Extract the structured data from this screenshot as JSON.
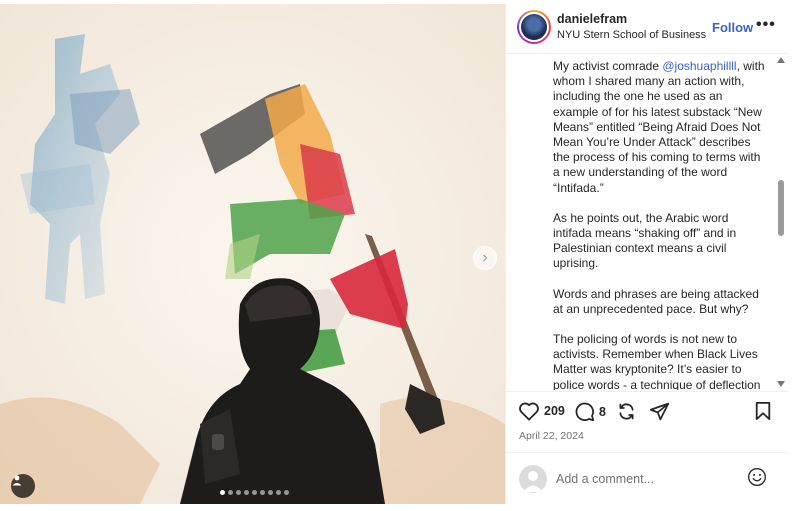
{
  "post": {
    "username": "danielefram",
    "location": "NYU Stern School of Business",
    "follow_label": "Follow",
    "more_label": "•••",
    "caption": {
      "p1_before": "My activist comrade ",
      "mention": "@joshuaphillll",
      "p1_after": ", with whom I shared many an action with, including the one he used as an example of for his latest substack “New Means” entitled “Being Afraid Does Not Mean You’re Under Attack” describes the process of his coming to terms with a new understanding of the word “Intifada.”",
      "p2": "As he points out, the Arabic word intifada means “shaking off” and in Palestinian context means a civil uprising.",
      "p3": "Words and phrases are being attacked at an unprecedented pace. But why?",
      "p4": "The policing of words is not new to activists. Remember when Black Lives Matter was kryptonite? It’s easier to police words - a technique of deflection"
    },
    "likes": "209",
    "comments": "8",
    "date": "April 22, 2024",
    "comment_placeholder": "Add a comment..."
  },
  "carousel": {
    "total_dots": 9,
    "active_index": 0
  },
  "icons": {
    "like": "heart-icon",
    "comment": "comment-icon",
    "repost": "repost-icon",
    "share": "share-icon",
    "save": "bookmark-icon",
    "emoji": "emoji-icon",
    "next": "chevron-right-icon",
    "tag": "user-tag-icon"
  },
  "colors": {
    "link": "#3b63c8",
    "text": "#262626",
    "muted": "#737373",
    "flag_red": "#d8283a",
    "flag_green": "#3d9a3a"
  }
}
